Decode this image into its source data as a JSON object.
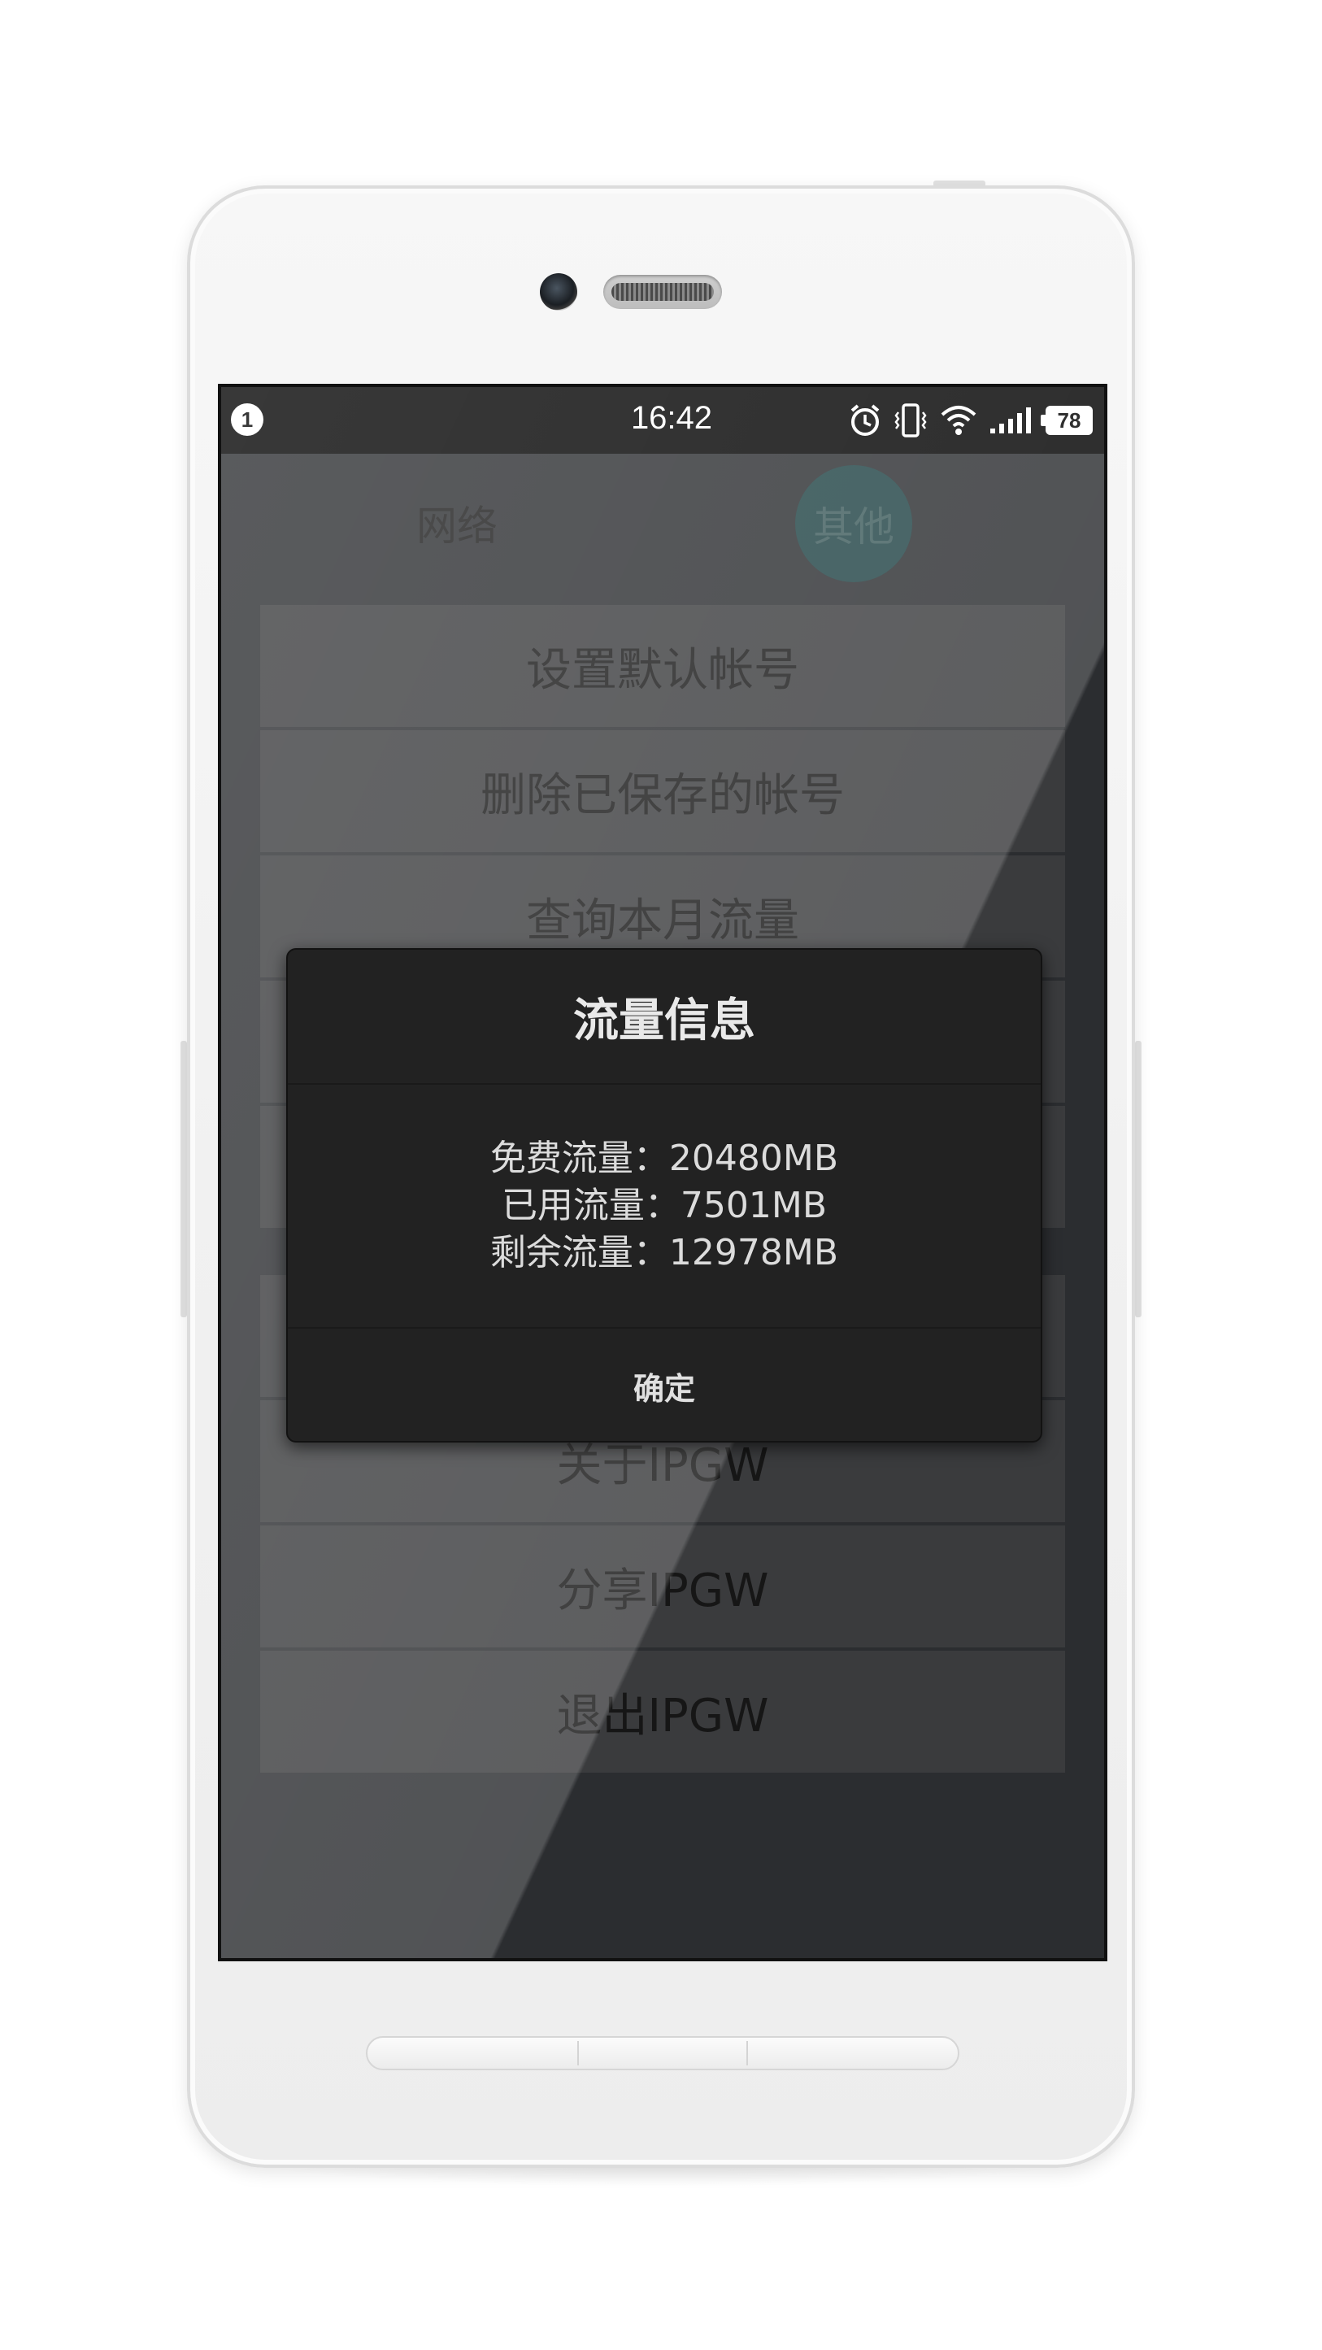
{
  "status_bar": {
    "notification_count": "1",
    "time": "16:42",
    "battery": "78",
    "icons": [
      "alarm-icon",
      "vibrate-icon",
      "wifi-icon",
      "signal-icon",
      "battery-icon"
    ]
  },
  "tabs": [
    {
      "label": "网络"
    },
    {
      "label": "其他"
    }
  ],
  "menu": {
    "items": [
      {
        "label": "设置默认帐号"
      },
      {
        "label": "删除已保存的帐号"
      },
      {
        "label": "查询本月流量"
      },
      {
        "label": ""
      },
      {
        "label": ""
      },
      {
        "label": ""
      },
      {
        "label": "关于IPGW"
      },
      {
        "label": "分享IPGW"
      },
      {
        "label": "退出IPGW"
      }
    ]
  },
  "dialog": {
    "title": "流量信息",
    "lines": [
      "免费流量：20480MB",
      "已用流量：7501MB",
      "剩余流量：12978MB"
    ],
    "ok_label": "确定"
  },
  "colors": {
    "accent_tab": "#1f4244",
    "dialog_bg": "#222222",
    "overlay": "#2b2d30"
  }
}
